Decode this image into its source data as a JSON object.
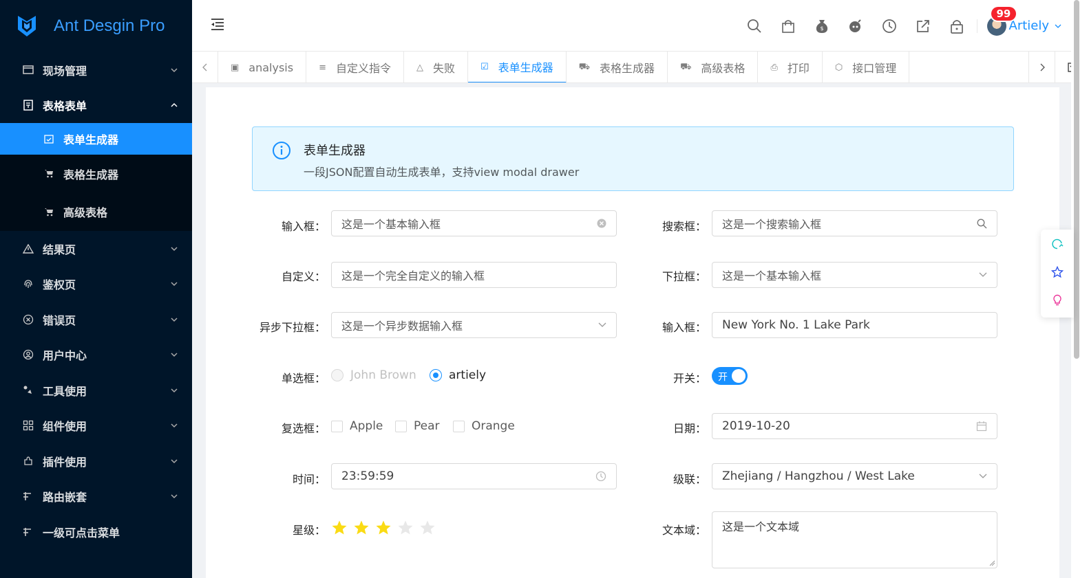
{
  "app": {
    "title": "Ant Desgin Pro"
  },
  "sidebar": {
    "items": [
      {
        "label": "现场管理",
        "icon": "monitor-icon"
      },
      {
        "label": "表格表单",
        "icon": "form-icon",
        "open": true
      },
      {
        "label": "结果页",
        "icon": "warning-icon"
      },
      {
        "label": "鉴权页",
        "icon": "fingerprint-icon"
      },
      {
        "label": "错误页",
        "icon": "close-circle-icon"
      },
      {
        "label": "用户中心",
        "icon": "user-circle-icon"
      },
      {
        "label": "工具使用",
        "icon": "tool-icon"
      },
      {
        "label": "组件使用",
        "icon": "appstore-icon"
      },
      {
        "label": "插件使用",
        "icon": "plugin-icon"
      },
      {
        "label": "路由嵌套",
        "icon": "route-icon"
      },
      {
        "label": "一级可点击菜单",
        "icon": "route-icon"
      }
    ],
    "subitems": [
      {
        "label": "表单生成器",
        "icon": "calendar-check-icon",
        "active": true
      },
      {
        "label": "表格生成器",
        "icon": "cart-icon"
      },
      {
        "label": "高级表格",
        "icon": "cart-icon"
      }
    ]
  },
  "header": {
    "user": {
      "name": "Artiely",
      "badge": "99"
    },
    "icons": [
      "search-icon",
      "shopping-bag-icon",
      "money-bag-icon",
      "bomb-icon",
      "clock-icon",
      "export-icon",
      "lock-icon"
    ]
  },
  "tabs": [
    {
      "label": "analysis",
      "icon": "picture-icon"
    },
    {
      "label": "自定义指令",
      "icon": "bars-icon"
    },
    {
      "label": "失败",
      "icon": "warning-icon"
    },
    {
      "label": "表单生成器",
      "icon": "calendar-check-icon",
      "active": true
    },
    {
      "label": "表格生成器",
      "icon": "cart-icon"
    },
    {
      "label": "高级表格",
      "icon": "cart-icon"
    },
    {
      "label": "打印",
      "icon": "printer-icon"
    },
    {
      "label": "接口管理",
      "icon": "api-icon"
    }
  ],
  "alert": {
    "title": "表单生成器",
    "description": "一段JSON配置自动生成表单，支持view modal drawer"
  },
  "form": {
    "input": {
      "label": "输入框：",
      "value": "这是一个基本输入框"
    },
    "search": {
      "label": "搜索框：",
      "value": "这是一个搜索输入框"
    },
    "custom": {
      "label": "自定义：",
      "value": "这是一个完全自定义的输入框"
    },
    "select": {
      "label": "下拉框：",
      "value": "这是一个基本输入框"
    },
    "async_select": {
      "label": "异步下拉框：",
      "value": "这是一个异步数据输入框"
    },
    "input2": {
      "label": "输入框：",
      "value": "New York No. 1 Lake Park"
    },
    "radio": {
      "label": "单选框：",
      "options": [
        "John Brown",
        "artiely"
      ],
      "selected": "artiely"
    },
    "switch": {
      "label": "开关：",
      "text": "开",
      "on": true
    },
    "checkbox": {
      "label": "复选框：",
      "options": [
        "Apple",
        "Pear",
        "Orange"
      ]
    },
    "date": {
      "label": "日期：",
      "value": "2019-10-20"
    },
    "time": {
      "label": "时间：",
      "value": "23:59:59"
    },
    "cascader": {
      "label": "级联：",
      "value": "Zhejiang / Hangzhou / West Lake"
    },
    "rate": {
      "label": "星级：",
      "value": 3,
      "max": 5
    },
    "textarea": {
      "label": "文本域：",
      "value": "这是一个文本域"
    }
  },
  "colors": {
    "primary": "#1890ff",
    "sider": "#001529",
    "star": "#fadb14"
  }
}
